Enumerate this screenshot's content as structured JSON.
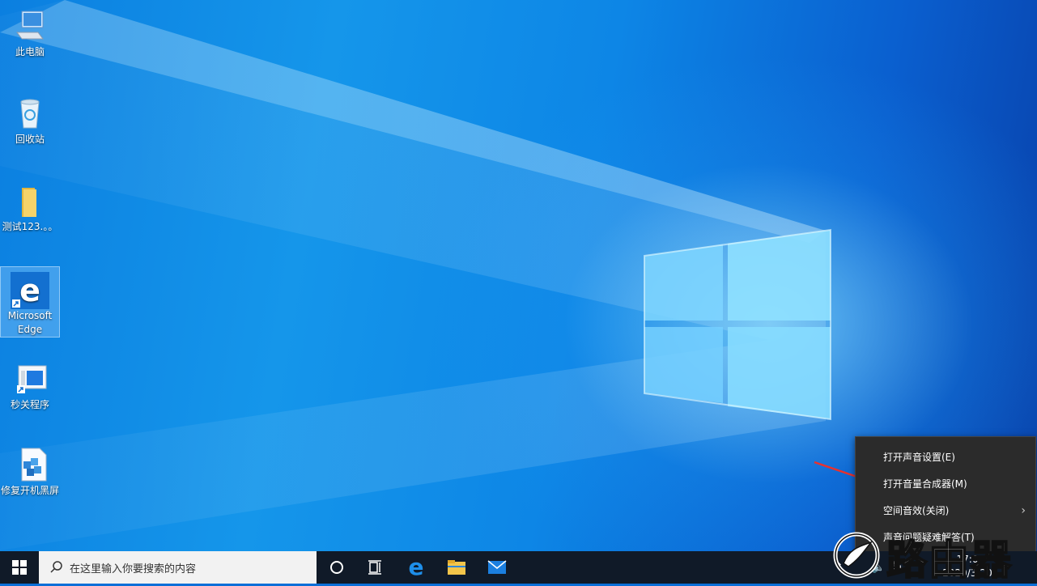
{
  "desktop": {
    "icons": [
      {
        "label": "此电脑",
        "icon": "computer-icon"
      },
      {
        "label": "回收站",
        "icon": "recycle-bin-icon"
      },
      {
        "label": "测试123.。。",
        "icon": "folder-icon"
      },
      {
        "label": "Microsoft Edge",
        "icon": "edge-icon"
      },
      {
        "label": "秒关程序",
        "icon": "app-shortcut-icon"
      },
      {
        "label": "修复开机黑屏",
        "icon": "script-file-icon"
      }
    ]
  },
  "context_menu": {
    "items": [
      {
        "label": "打开声音设置(E)"
      },
      {
        "label": "打开音量合成器(M)"
      },
      {
        "label": "空间音效(关闭)",
        "has_submenu": true
      },
      {
        "label": "声音问题疑难解答(T)"
      }
    ]
  },
  "taskbar": {
    "search_placeholder": "在这里输入你要搜索的内容",
    "apps": [
      "cortana-icon",
      "task-view-icon",
      "edge-icon",
      "file-explorer-icon",
      "mail-icon"
    ],
    "tray": {
      "input_lang": "英",
      "time": "17:0",
      "date": "2020/3/20"
    }
  },
  "watermark": {
    "text": "路由器"
  },
  "colors": {
    "taskbar": "#101a28",
    "menu_bg": "#2b2b2b",
    "accent_arrow": "#e8322f"
  }
}
